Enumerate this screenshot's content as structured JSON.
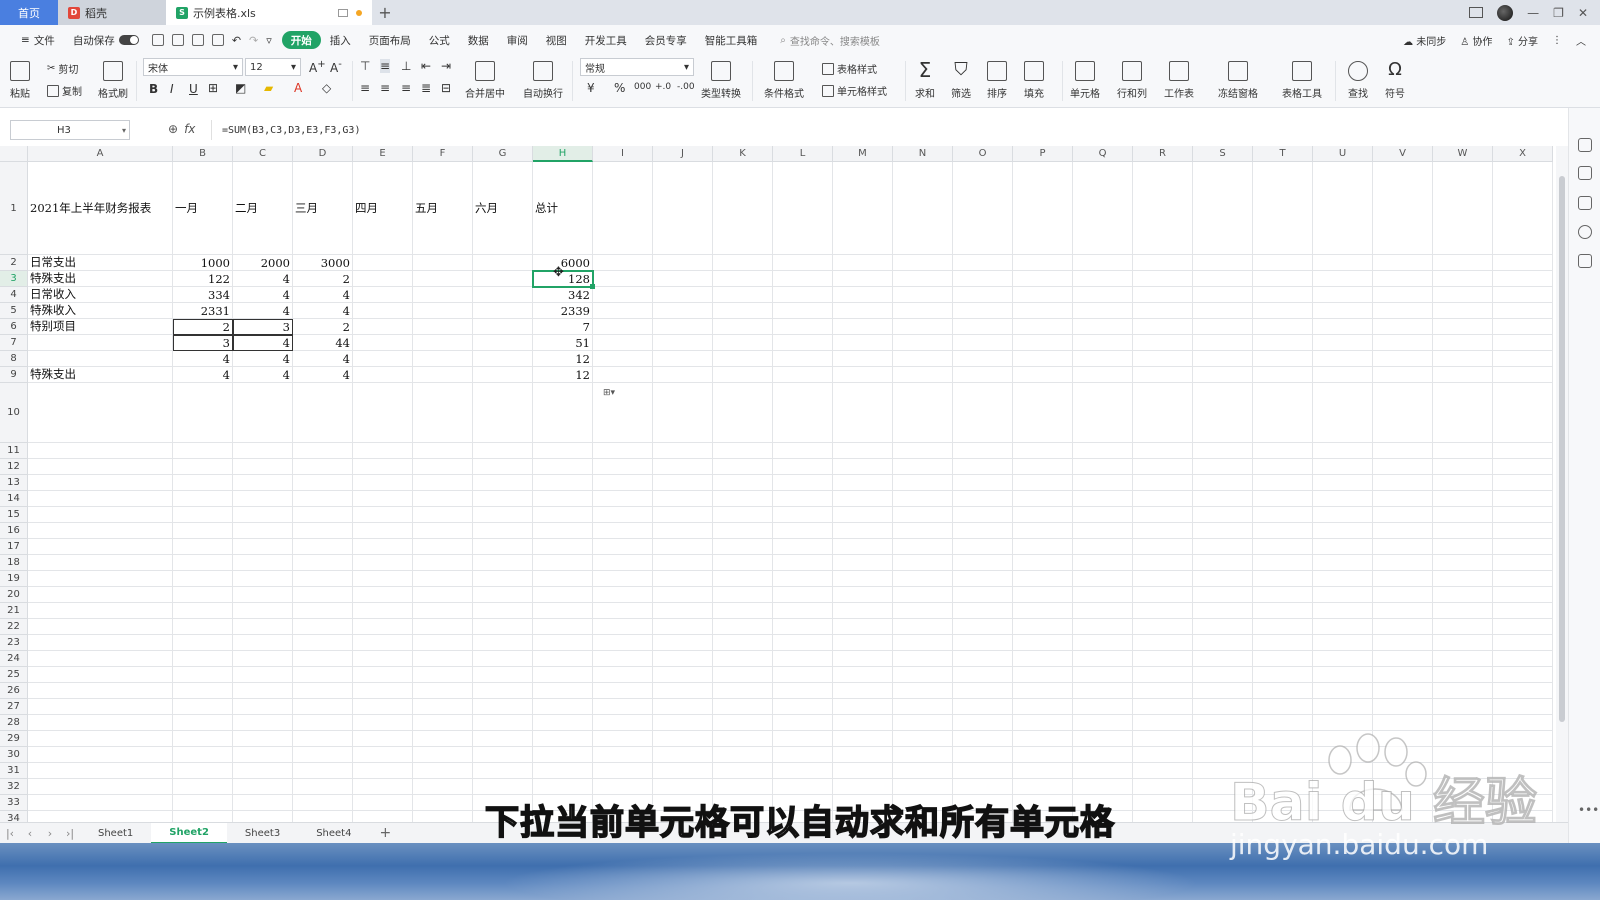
{
  "tabs": {
    "home": "首页",
    "docer": "稻壳",
    "doc": "示例表格.xls"
  },
  "menubar": {
    "file": "文件",
    "autosave": "自动保存",
    "items": [
      "开始",
      "插入",
      "页面布局",
      "公式",
      "数据",
      "审阅",
      "视图",
      "开发工具",
      "会员专享",
      "智能工具箱"
    ],
    "active_index": 0,
    "search_placeholder": "查找命令、搜索模板",
    "right": [
      "未同步",
      "协作",
      "分享"
    ]
  },
  "ribbon": {
    "paste": "粘贴",
    "cut": "剪切",
    "copy": "复制",
    "format_painter": "格式刷",
    "font_name": "宋体",
    "font_size": "12",
    "bold": "B",
    "italic": "I",
    "underline": "U",
    "merge_center": "合并居中",
    "wrap_text": "自动换行",
    "number_format": "常规",
    "currency": "¥",
    "percent": "%",
    "thousands": "000",
    "inc_decimal": "+.0",
    "dec_decimal": "-.00",
    "type_convert": "类型转换",
    "cond_format": "条件格式",
    "table_style": "表格样式",
    "cell_style": "单元格样式",
    "sum": "求和",
    "filter": "筛选",
    "sort": "排序",
    "fill": "填充",
    "cell": "单元格",
    "row_col": "行和列",
    "worksheet": "工作表",
    "freeze": "冻结窗格",
    "table_tools": "表格工具",
    "find": "查找",
    "symbol": "符号"
  },
  "formula_bar": {
    "cell_ref": "H3",
    "fx": "fx",
    "formula": "=SUM(B3,C3,D3,E3,F3,G3)"
  },
  "grid": {
    "columns": [
      "A",
      "B",
      "C",
      "D",
      "E",
      "F",
      "G",
      "H",
      "I",
      "J",
      "K",
      "L",
      "M",
      "N",
      "O",
      "P",
      "Q",
      "R",
      "S",
      "T",
      "U",
      "V",
      "W",
      "X"
    ],
    "selected_column": "H",
    "selected_row": "3",
    "rows": [
      {
        "n": "1",
        "cells": [
          "2021年上半年财务报表",
          "一月",
          "二月",
          "三月",
          "四月",
          "五月",
          "六月",
          "总计"
        ]
      },
      {
        "n": "2",
        "cells": [
          "日常支出",
          "1000",
          "2000",
          "3000",
          "",
          "",
          "",
          "6000"
        ]
      },
      {
        "n": "3",
        "cells": [
          "特殊支出",
          "122",
          "4",
          "2",
          "",
          "",
          "",
          "128"
        ]
      },
      {
        "n": "4",
        "cells": [
          "日常收入",
          "334",
          "4",
          "4",
          "",
          "",
          "",
          "342"
        ]
      },
      {
        "n": "5",
        "cells": [
          "特殊收入",
          "2331",
          "4",
          "4",
          "",
          "",
          "",
          "2339"
        ]
      },
      {
        "n": "6",
        "cells": [
          "特别项目",
          "2",
          "3",
          "2",
          "",
          "",
          "",
          "7"
        ]
      },
      {
        "n": "7",
        "cells": [
          "",
          "3",
          "4",
          "44",
          "",
          "",
          "",
          "51"
        ]
      },
      {
        "n": "8",
        "cells": [
          "",
          "4",
          "4",
          "4",
          "",
          "",
          "",
          "12"
        ]
      },
      {
        "n": "9",
        "cells": [
          "特殊支出",
          "4",
          "4",
          "4",
          "",
          "",
          "",
          "12"
        ]
      }
    ],
    "empty_rows": [
      "10",
      "11",
      "12",
      "13",
      "14",
      "15",
      "16",
      "17",
      "18",
      "19",
      "20",
      "21",
      "22",
      "23",
      "24",
      "25",
      "26",
      "27",
      "28",
      "29",
      "30",
      "31",
      "32",
      "33",
      "34"
    ]
  },
  "sheets": {
    "tabs": [
      "Sheet1",
      "Sheet2",
      "Sheet3",
      "Sheet4"
    ],
    "active_index": 1
  },
  "overlay": {
    "subtitle": "下拉当前单元格可以自动求和所有单元格",
    "watermark_logo": "Bai du 经验",
    "watermark_url": "jingyan.baidu.com"
  },
  "colors": {
    "accent": "#21a366",
    "home_tab": "#4a7fe0"
  }
}
